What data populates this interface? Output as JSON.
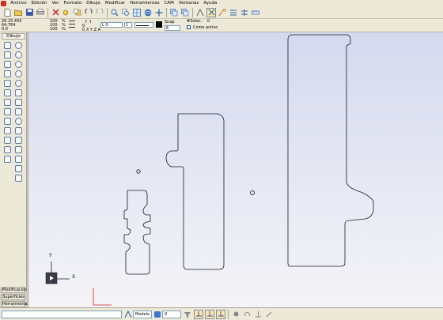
{
  "menubar": {
    "items": [
      "Archivo",
      "Edición",
      "Ver",
      "Formato",
      "Dibujo",
      "Modificar",
      "Herramientas",
      "CAM",
      "Ventanas",
      "Ayuda"
    ]
  },
  "toolbar": {
    "icons": [
      "new-file-icon",
      "open-folder-icon",
      "save-icon",
      "print-icon",
      "cut-icon",
      "copy-icon",
      "paste-icon",
      "undo-icon",
      "redo-icon",
      "zoom-icon",
      "zoom-window-icon",
      "zoom-extents-icon",
      "orbit-icon",
      "pan-icon",
      "layers-icon",
      "layer-list-icon",
      "snap-icon",
      "ortho-icon",
      "properties-icon",
      "align-icon",
      "distribute-icon",
      "measure-icon"
    ]
  },
  "propbar": {
    "coord_x": "26.15.455",
    "coord_y": "64.764",
    "coord_z": "0.0",
    "val_100_a": "100",
    "val_100_b": "100",
    "val_100_c": "100",
    "pct": "%",
    "angle": "0",
    "zero_1": "0",
    "zero_2": "0",
    "xyz_label": "X Y Z A",
    "width_label": "L",
    "width_value": "0",
    "line_count": "1",
    "snap_label": "Snap",
    "snap_value": "6",
    "sel_label": "#Selec.",
    "sel_value": "0",
    "active_label": "Como activo"
  },
  "sidepanel": {
    "title": "Dibujo",
    "tabs": [
      "Modificación",
      "Superficies",
      "Herramientas"
    ]
  },
  "canvas": {
    "ucs_y": "Y",
    "ucs_x": "X",
    "accent": "#d02020"
  },
  "statusbar": {
    "command_value": "",
    "space_label": "Modelo",
    "layer_value": "0"
  }
}
